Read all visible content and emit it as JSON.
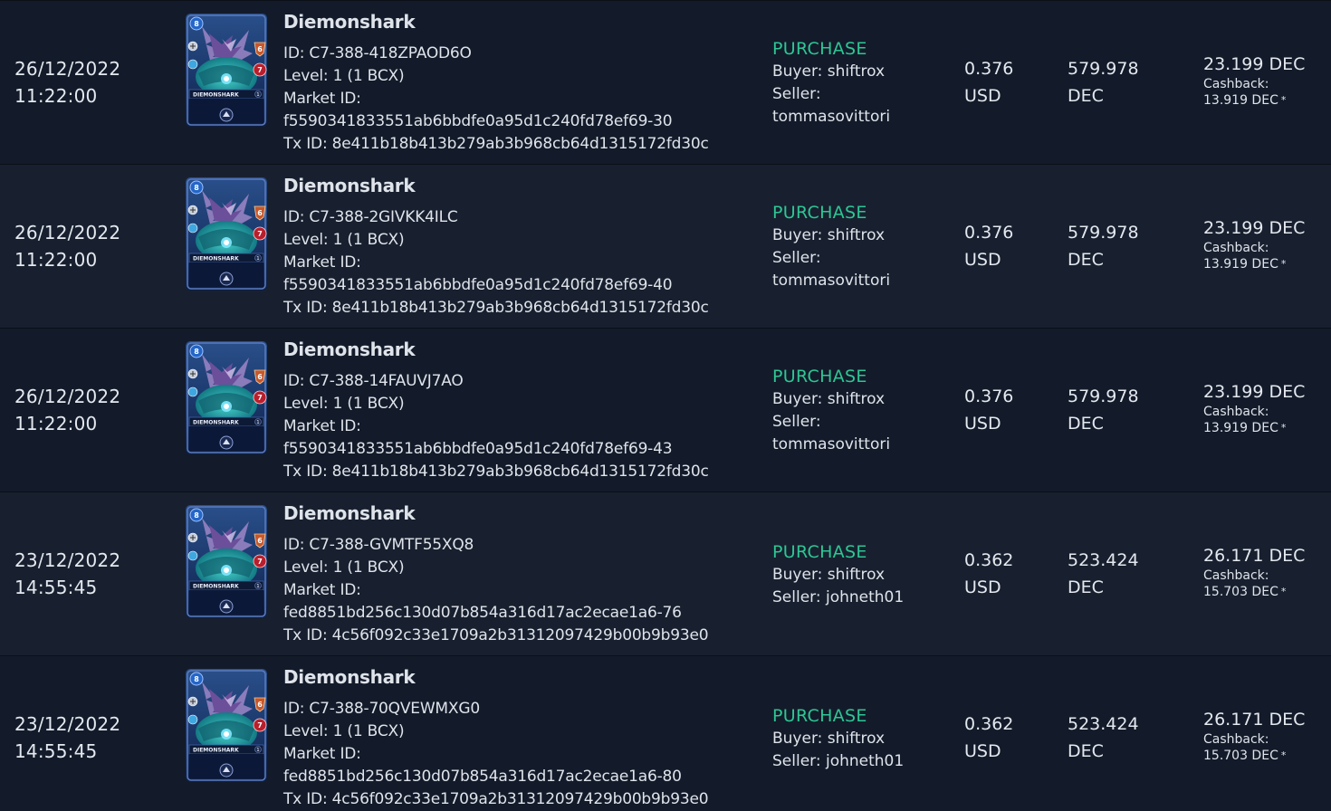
{
  "sales": [
    {
      "date": "26/12/2022",
      "time": "11:22:00",
      "card_name": "Diemonshark",
      "card_id": "ID: C7-388-418ZPAOD6O",
      "level": "Level: 1 (1 BCX)",
      "market_label": "Market ID:",
      "market_id": "f5590341833551ab6bbdfe0a95d1c240fd78ef69-30",
      "tx_id": "Tx ID: 8e411b18b413b279ab3b968cb64d1315172fd30c",
      "type": "PURCHASE",
      "buyer": "Buyer: shiftrox",
      "seller_label": "Seller:",
      "seller_name": "tommasovittori",
      "usd_value": "0.376",
      "usd_unit": "USD",
      "dec_value": "579.978",
      "dec_unit": "DEC",
      "total": "23.199 DEC",
      "cashback_label": "Cashback:",
      "cashback_value": "13.919 DEC",
      "star": "*"
    },
    {
      "date": "26/12/2022",
      "time": "11:22:00",
      "card_name": "Diemonshark",
      "card_id": "ID: C7-388-2GIVKK4ILC",
      "level": "Level: 1 (1 BCX)",
      "market_label": "Market ID:",
      "market_id": "f5590341833551ab6bbdfe0a95d1c240fd78ef69-40",
      "tx_id": "Tx ID: 8e411b18b413b279ab3b968cb64d1315172fd30c",
      "type": "PURCHASE",
      "buyer": "Buyer: shiftrox",
      "seller_label": "Seller:",
      "seller_name": "tommasovittori",
      "usd_value": "0.376",
      "usd_unit": "USD",
      "dec_value": "579.978",
      "dec_unit": "DEC",
      "total": "23.199 DEC",
      "cashback_label": "Cashback:",
      "cashback_value": "13.919 DEC",
      "star": "*"
    },
    {
      "date": "26/12/2022",
      "time": "11:22:00",
      "card_name": "Diemonshark",
      "card_id": "ID: C7-388-14FAUVJ7AO",
      "level": "Level: 1 (1 BCX)",
      "market_label": "Market ID:",
      "market_id": "f5590341833551ab6bbdfe0a95d1c240fd78ef69-43",
      "tx_id": "Tx ID: 8e411b18b413b279ab3b968cb64d1315172fd30c",
      "type": "PURCHASE",
      "buyer": "Buyer: shiftrox",
      "seller_label": "Seller:",
      "seller_name": "tommasovittori",
      "usd_value": "0.376",
      "usd_unit": "USD",
      "dec_value": "579.978",
      "dec_unit": "DEC",
      "total": "23.199 DEC",
      "cashback_label": "Cashback:",
      "cashback_value": "13.919 DEC",
      "star": "*"
    },
    {
      "date": "23/12/2022",
      "time": "14:55:45",
      "card_name": "Diemonshark",
      "card_id": "ID: C7-388-GVMTF55XQ8",
      "level": "Level: 1 (1 BCX)",
      "market_label": "Market ID:",
      "market_id": "fed8851bd256c130d07b854a316d17ac2ecae1a6-76",
      "tx_id": "Tx ID: 4c56f092c33e1709a2b31312097429b00b9b93e0",
      "type": "PURCHASE",
      "buyer": "Buyer: shiftrox",
      "seller_label": "Seller: johneth01",
      "seller_name": "",
      "usd_value": "0.362",
      "usd_unit": "USD",
      "dec_value": "523.424",
      "dec_unit": "DEC",
      "total": "26.171 DEC",
      "cashback_label": "Cashback:",
      "cashback_value": "15.703 DEC",
      "star": "*"
    },
    {
      "date": "23/12/2022",
      "time": "14:55:45",
      "card_name": "Diemonshark",
      "card_id": "ID: C7-388-70QVEWMXG0",
      "level": "Level: 1 (1 BCX)",
      "market_label": "Market ID:",
      "market_id": "fed8851bd256c130d07b854a316d17ac2ecae1a6-80",
      "tx_id": "Tx ID: 4c56f092c33e1709a2b31312097429b00b9b93e0",
      "type": "PURCHASE",
      "buyer": "Buyer: shiftrox",
      "seller_label": "Seller: johneth01",
      "seller_name": "",
      "usd_value": "0.362",
      "usd_unit": "USD",
      "dec_value": "523.424",
      "dec_unit": "DEC",
      "total": "26.171 DEC",
      "cashback_label": "Cashback:",
      "cashback_value": "15.703 DEC",
      "star": "*"
    }
  ],
  "card_art": {
    "mana": "8",
    "attack": "6",
    "health": "7",
    "banner": "DIEMONSHARK",
    "level": "1"
  },
  "colors": {
    "purchase": "#2ec694",
    "row_dark": "#131b2a",
    "row_light": "#18202f"
  }
}
